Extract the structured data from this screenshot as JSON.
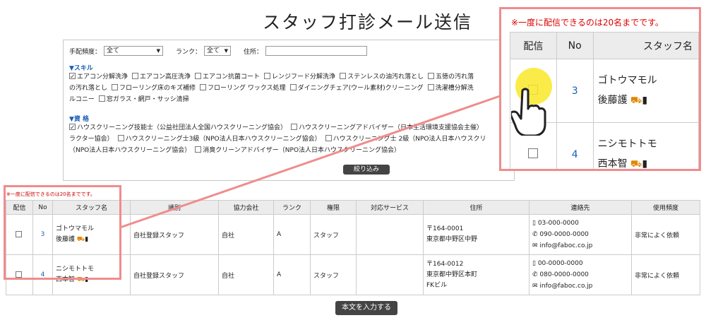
{
  "page": {
    "title": "スタッフ打診メール送信"
  },
  "filters": {
    "frequency_label": "手配頻度：",
    "frequency_value": "全て",
    "rank_label": "ランク：",
    "rank_value": "全て",
    "address_label": "住所：",
    "address_value": ""
  },
  "skills": {
    "heading": "▼スキル",
    "line1": [
      {
        "label": "エアコン分解洗浄",
        "checked": true
      },
      {
        "label": "エアコン高圧洗浄",
        "checked": false
      },
      {
        "label": "エアコン抗菌コート",
        "checked": false
      },
      {
        "label": "レンジフード分解洗浄",
        "checked": false
      },
      {
        "label": "ステンレスの油汚れ落とし",
        "checked": false
      },
      {
        "label": "五徳の汚れ落",
        "checked": false
      }
    ],
    "line2_prefix": "の汚れ落とし",
    "line2": [
      {
        "label": "フローリング床のキズ補修",
        "checked": false
      },
      {
        "label": "フローリング ワックス処理",
        "checked": false
      },
      {
        "label": "ダイニングチェア(ウール素材)クリーニング",
        "checked": false
      },
      {
        "label": "洗濯槽分解洗",
        "checked": false
      }
    ],
    "line3_prefix": "ルコニー",
    "line3": [
      {
        "label": "窓ガラス・網戸・サッシ清掃",
        "checked": false
      }
    ]
  },
  "qualifications": {
    "heading": "▼資 格",
    "line1": [
      {
        "label": "ハウスクリーニング技能士（公益社団法人全国ハウスクリーニング協会）",
        "checked": true
      },
      {
        "label": "ハウスクリーニングアドバイザー（日本生活環境支援協会主催）",
        "checked": false
      }
    ],
    "line2_prefix": "ラクター協会）",
    "line2": [
      {
        "label": "ハウスクリーニング士3級（NPO法人日本ハウスクリーニング協会）",
        "checked": false
      },
      {
        "label": "ハウスクリーニング士 2級（NPO法人日本ハウスクリ",
        "checked": false
      }
    ],
    "line3_prefix": "（NPO法人日本ハウスクリーニング協会）",
    "line3": [
      {
        "label": "消臭クリーンアドバイザー（NPO法人日本ハウスクリーニング協会）",
        "checked": false
      }
    ]
  },
  "filter_button": "絞り込み",
  "notice": "※一度に配信できるのは20名までです。",
  "table": {
    "headers": [
      "配信",
      "No",
      "スタッフ名",
      "識別",
      "協力会社",
      "ランク",
      "権限",
      "対応サービス",
      "住所",
      "連絡先",
      "使用頻度"
    ],
    "rows": [
      {
        "no": "3",
        "name_kana": "ゴトウマモル",
        "name": "後藤護",
        "type": "自社登録スタッフ",
        "company": "自社",
        "rank": "A",
        "role": "スタッフ",
        "services": "",
        "postal": "〒164-0001",
        "address1": "東京都中野区中野",
        "address2": "",
        "mobile": "03-000-0000",
        "phone": "090-0000-0000",
        "email": "info@faboc.co.jp",
        "frequency": "非常によく依頼"
      },
      {
        "no": "4",
        "name_kana": "ニシモトトモ",
        "name": "西本智",
        "type": "自社登録スタッフ",
        "company": "自社",
        "rank": "A",
        "role": "スタッフ",
        "services": "",
        "postal": "〒164-0012",
        "address1": "東京都中野区本町",
        "address2": "FKビル",
        "mobile": "00-0000-0000",
        "phone": "080-0000-0000",
        "email": "info@faboc.co.jp",
        "frequency": "非常によく依頼"
      }
    ]
  },
  "submit_button": "本文を入力する",
  "zoom": {
    "notice": "※一度に配信できるのは20名までです。",
    "headers": [
      "配信",
      "No",
      "スタッフ名"
    ],
    "rows": [
      {
        "no": "3",
        "name_kana": "ゴトウマモル",
        "name": "後藤護"
      },
      {
        "no": "4",
        "name_kana": "ニシモトトモ",
        "name": "西本智"
      }
    ]
  },
  "colors": {
    "accent_link": "#1a5fb4",
    "notice_red": "#cc0000",
    "highlight_border": "#f08c8c",
    "button_dark": "#444444"
  }
}
